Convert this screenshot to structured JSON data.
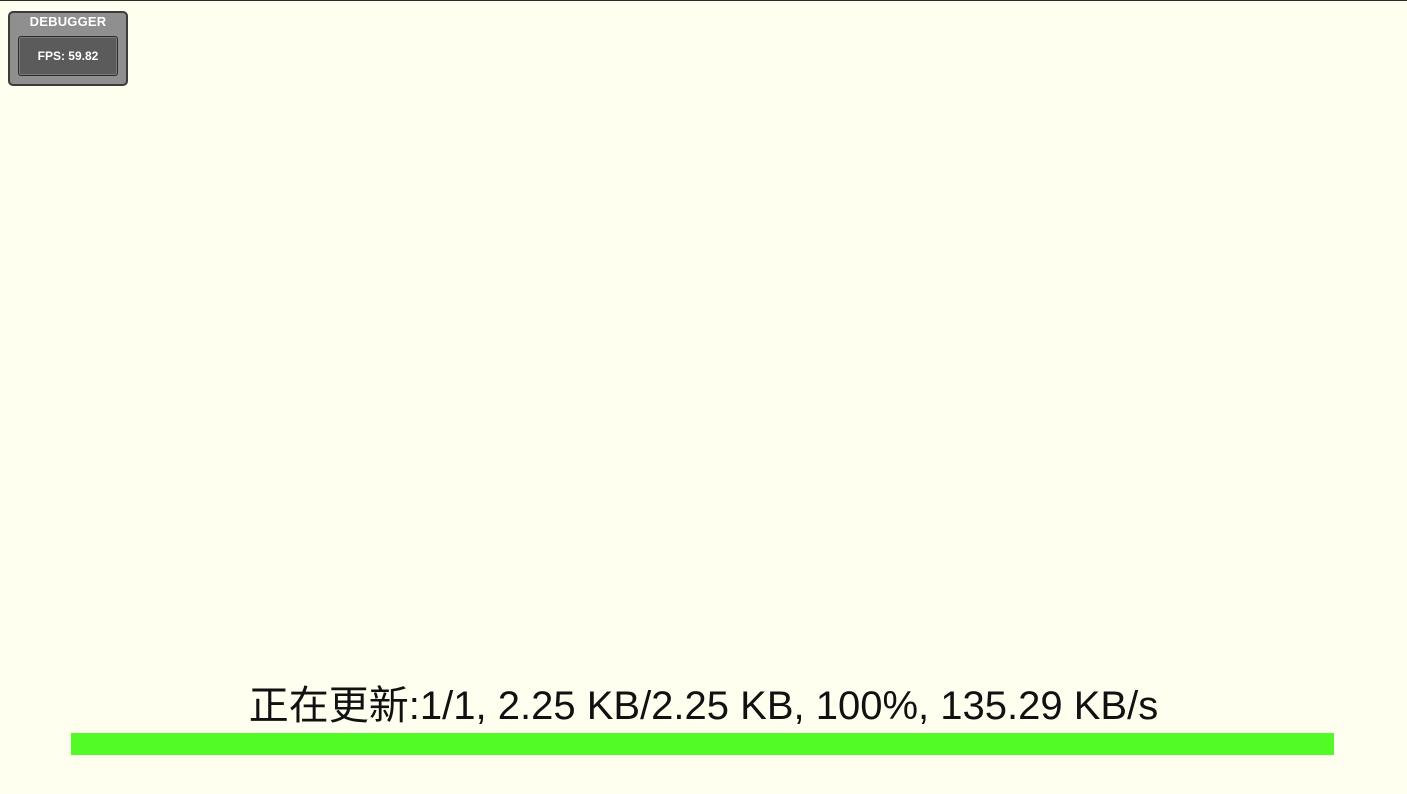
{
  "debugger": {
    "title": "DEBUGGER",
    "fps_text": "FPS: 59.82"
  },
  "update": {
    "status_text": "正在更新:1/1, 2.25 KB/2.25 KB, 100%, 135.29 KB/s",
    "progress_fraction": 1.0,
    "progress_color": "#52fb26"
  },
  "colors": {
    "background": "#fffff0"
  }
}
